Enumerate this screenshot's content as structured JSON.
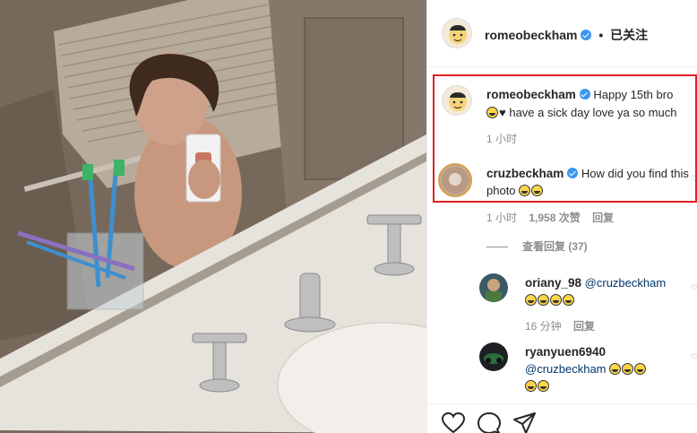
{
  "post": {
    "author": "romeobeckham",
    "follow_status": "已关注",
    "separator": "•"
  },
  "caption": {
    "username": "romeobeckham",
    "text": "Happy 15th bro",
    "text2": "have a sick day love ya so much",
    "time": "1 小时"
  },
  "comments": [
    {
      "username": "cruzbeckham",
      "text": "How did you find this photo",
      "time": "1 小时",
      "likes": "1,958 次赞",
      "reply": "回复",
      "view_replies": "查看回复 (37)"
    }
  ],
  "replies": [
    {
      "username": "oriany_98",
      "mention": "@cruzbeckham",
      "time": "16 分钟",
      "reply": "回复"
    },
    {
      "username": "ryanyuen6940",
      "mention": "@cruzbeckham"
    }
  ],
  "colors": {
    "verified": "#3897f0",
    "highlight_box": "#e02020",
    "meta_text": "#8e8e8e"
  },
  "icons": [
    "heart-icon",
    "comment-icon",
    "share-icon",
    "verified-badge-icon",
    "laughing-emoji-icon"
  ]
}
